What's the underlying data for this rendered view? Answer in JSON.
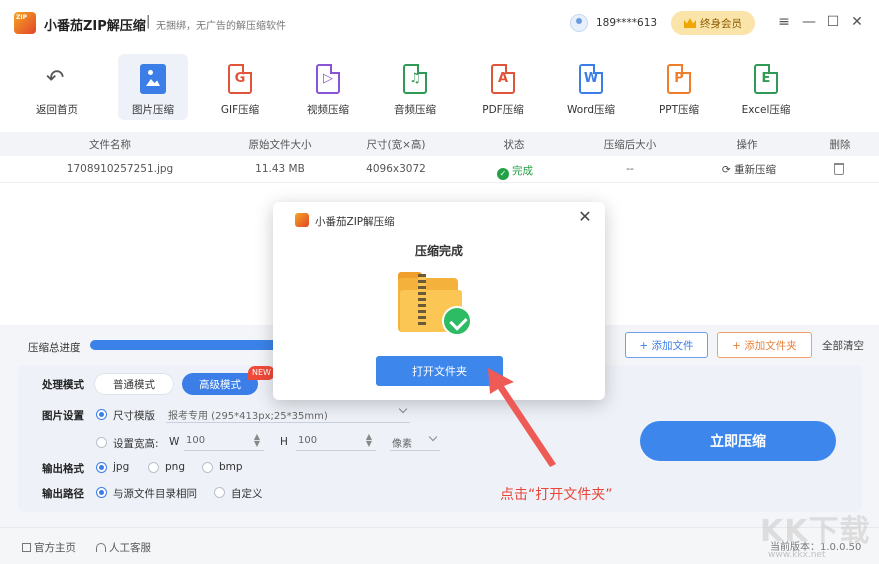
{
  "titlebar": {
    "app_name": "小番茄ZIP解压缩",
    "separator": "|",
    "slogan": "无捆绑，无广告的解压缩软件",
    "phone": "189****613",
    "vip_label": "终身会员",
    "menu": "≡",
    "minimize": "—",
    "maximize": "☐",
    "close": "✕"
  },
  "toolbar": {
    "back_label": "返回首页",
    "tools": [
      {
        "label": "图片压缩",
        "active": true
      },
      {
        "label": "GIF压缩",
        "letter": "G",
        "color": "#e0553a"
      },
      {
        "label": "视频压缩",
        "letter": "▷",
        "color": "#8a54d6"
      },
      {
        "label": "音频压缩",
        "letter": "♫",
        "color": "#2f9a55"
      },
      {
        "label": "PDF压缩",
        "letter": "A",
        "color": "#e0553a"
      },
      {
        "label": "Word压缩",
        "letter": "W",
        "color": "#3b7ee8"
      },
      {
        "label": "PPT压缩",
        "letter": "P",
        "color": "#ef7d2a"
      },
      {
        "label": "Excel压缩",
        "letter": "E",
        "color": "#2f9a55"
      }
    ]
  },
  "table": {
    "headers": [
      "文件名称",
      "原始文件大小",
      "尺寸(宽×高)",
      "状态",
      "压缩后大小",
      "操作",
      "删除"
    ],
    "rows": [
      {
        "name": "1708910257251.jpg",
        "size": "11.43 MB",
        "dims": "4096x3072",
        "status": "完成",
        "compressed": "--",
        "action": "重新压缩"
      }
    ]
  },
  "progress": {
    "label": "压缩总进度"
  },
  "buttons": {
    "add_file": "+ 添加文件",
    "add_folder": "+ 添加文件夹",
    "clear_all": "全部清空",
    "compress_now": "立即压缩"
  },
  "settings": {
    "mode_label": "处理模式",
    "mode_normal": "普通模式",
    "mode_adv": "高级模式",
    "new_badge": "NEW",
    "image_label": "图片设置",
    "size_template": "尺寸模版",
    "size_template_value": "报考专用 (295*413px;25*35mm)",
    "set_wh": "设置宽高:",
    "w_label": "W",
    "w_value": "100",
    "h_label": "H",
    "h_value": "100",
    "unit": "像素",
    "format_label": "输出格式",
    "formats": [
      "jpg",
      "png",
      "bmp"
    ],
    "path_label": "输出路径",
    "path_same": "与源文件目录相同",
    "path_custom": "自定义"
  },
  "footer": {
    "home": "官方主页",
    "service": "人工客服",
    "version": "当前版本：1.0.0.50"
  },
  "modal": {
    "title": "小番茄ZIP解压缩",
    "close": "✕",
    "heading": "压缩完成",
    "open_folder": "打开文件夹"
  },
  "annotation": {
    "hint": "点击“打开文件夹”"
  },
  "watermark": {
    "text": "KK下载",
    "url": "www.kkx.net"
  }
}
